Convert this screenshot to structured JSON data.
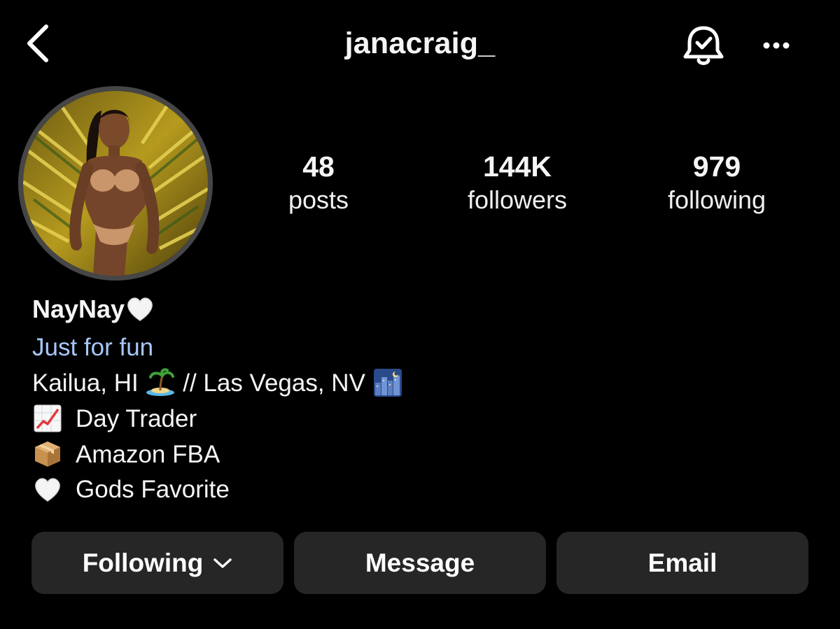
{
  "header": {
    "username": "janacraig_",
    "icons": [
      "back-chevron-icon",
      "notification-bell-check-icon",
      "more-options-icon"
    ]
  },
  "stats": {
    "posts": {
      "value": "48",
      "label": "posts"
    },
    "followers": {
      "value": "144K",
      "label": "followers"
    },
    "following": {
      "value": "979",
      "label": "following"
    }
  },
  "bio": {
    "display_name": "NayNay",
    "category": "Just for fun",
    "location_text_1": "Kailua, HI",
    "location_text_2": "// Las Vegas, NV",
    "line_1": "Day Trader",
    "line_2": "Amazon FBA",
    "line_3": "Gods Favorite",
    "emojis": [
      "white-heart",
      "desert-island",
      "night-city",
      "chart-increasing",
      "package",
      "white-heart"
    ]
  },
  "actions": {
    "following_label": "Following",
    "message_label": "Message",
    "email_label": "Email"
  },
  "colors": {
    "background": "#000000",
    "button_bg": "#262626",
    "category_text": "#a8c7fa",
    "avatar_ring": "#464646"
  }
}
